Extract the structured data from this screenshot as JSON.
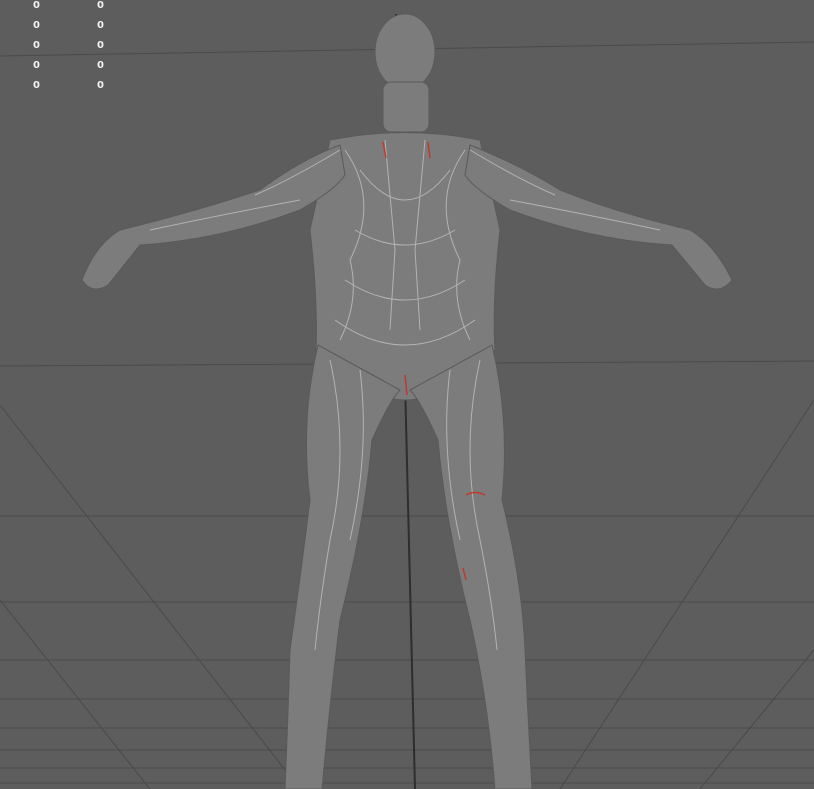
{
  "hud": {
    "rows": [
      {
        "left": "0",
        "right": "0"
      },
      {
        "left": "0",
        "right": "0"
      },
      {
        "left": "0",
        "right": "0"
      },
      {
        "left": "0",
        "right": "0"
      },
      {
        "left": "0",
        "right": "0"
      }
    ]
  },
  "colors": {
    "background": "#5d5d5d",
    "grid": "#4a4a4a",
    "model": "#7d7d7d",
    "muscle_lines": "#bdbdbd",
    "highlight": "#c0392b"
  }
}
